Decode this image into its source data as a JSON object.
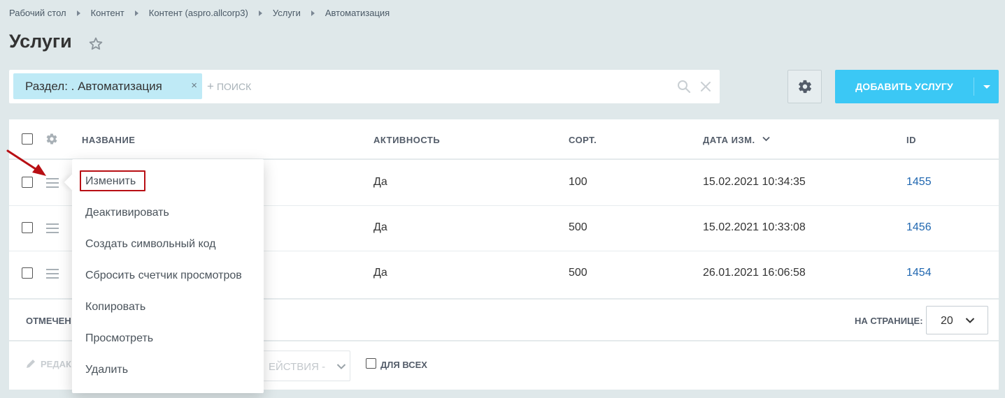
{
  "breadcrumb": [
    "Рабочий стол",
    "Контент",
    "Контент (aspro.allcorp3)",
    "Услуги",
    "Автоматизация"
  ],
  "page_title": "Услуги",
  "filter": {
    "chip_label": "Раздел: . Автоматизация",
    "chip_close": "×",
    "search_plus": "+",
    "search_placeholder": "поиск"
  },
  "toolbar": {
    "add_button_label": "ДОБАВИТЬ УСЛУГУ"
  },
  "table": {
    "columns": [
      "НАЗВАНИЕ",
      "АКТИВНОСТЬ",
      "СОРТ.",
      "ДАТА ИЗМ.",
      "ID"
    ],
    "rows": [
      {
        "active": "Да",
        "sort": "100",
        "date": "15.02.2021 10:34:35",
        "id": "1455"
      },
      {
        "active": "Да",
        "sort": "500",
        "date": "15.02.2021 10:33:08",
        "id": "1456"
      },
      {
        "active": "Да",
        "sort": "500",
        "date": "26.01.2021 16:06:58",
        "id": "1454"
      }
    ]
  },
  "footer": {
    "marked_label": "ОТМЕЧЕН",
    "per_page_label": "НА СТРАНИЦЕ:",
    "per_page_value": "20"
  },
  "actions": {
    "edit_label": "РЕДАК",
    "select_value": "ЕЙСТВИЯ -",
    "for_all_label": "ДЛЯ ВСЕХ"
  },
  "context_menu": {
    "items": [
      "Изменить",
      "Деактивировать",
      "Создать символьный код",
      "Сбросить счетчик просмотров",
      "Копировать",
      "Просмотреть",
      "Удалить"
    ],
    "highlighted_index": 0
  },
  "colors": {
    "accent": "#3bc8f5",
    "chip": "#bfeaf6",
    "link": "#2067b0",
    "annotation": "#b80f14",
    "background": "#dfe8ea"
  },
  "icons": [
    "star-icon",
    "search-icon",
    "close-icon",
    "gear-icon",
    "chevron-down-icon",
    "hamburger-icon",
    "pencil-icon"
  ]
}
